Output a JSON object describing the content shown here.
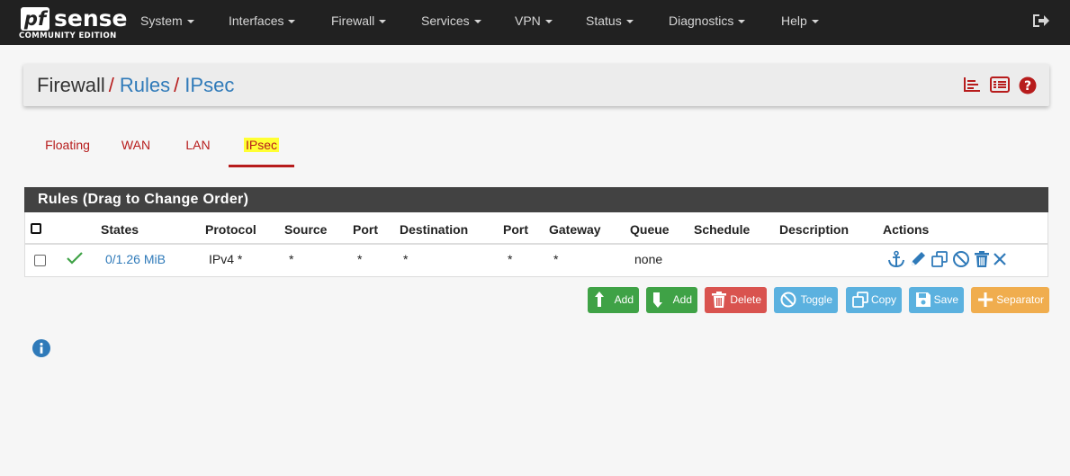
{
  "brand": {
    "logo_mark": "pf",
    "logo_word": "sense",
    "edition": "COMMUNITY EDITION"
  },
  "nav": {
    "items": [
      "System",
      "Interfaces",
      "Firewall",
      "Services",
      "VPN",
      "Status",
      "Diagnostics",
      "Help"
    ],
    "logout_icon": "sign-out-icon"
  },
  "breadcrumb": {
    "root": "Firewall",
    "sep1": "/",
    "level1": "Rules",
    "sep2": "/",
    "level2": "IPsec",
    "icons": [
      "chart-icon",
      "list-icon",
      "help-icon"
    ]
  },
  "tabs": [
    {
      "label": "Floating",
      "active": false
    },
    {
      "label": "WAN",
      "active": false
    },
    {
      "label": "LAN",
      "active": false
    },
    {
      "label": "IPsec",
      "active": true
    }
  ],
  "rules": {
    "title": "Rules (Drag to Change Order)",
    "columns": [
      "States",
      "Protocol",
      "Source",
      "Port",
      "Destination",
      "Port",
      "Gateway",
      "Queue",
      "Schedule",
      "Description",
      "Actions"
    ],
    "rows": [
      {
        "checked": false,
        "status": "check-icon",
        "states": "0/1.26 MiB",
        "protocol": "IPv4 *",
        "source": "*",
        "source_port": "*",
        "destination": "*",
        "destination_port": "*",
        "gateway": "*",
        "queue": "none",
        "schedule": "",
        "description": "",
        "actions": [
          "anchor-icon",
          "pencil-icon",
          "copy-icon",
          "disable-icon",
          "trash-icon",
          "times-icon"
        ]
      }
    ]
  },
  "buttons": {
    "add_top": "Add",
    "add_bottom": "Add",
    "delete": "Delete",
    "toggle": "Toggle",
    "copy": "Copy",
    "save": "Save",
    "separator": "Separator"
  },
  "colors": {
    "navbar": "#212121",
    "accent_red": "#b71c1c",
    "link_blue": "#2f7ab9",
    "green": "#3fa246",
    "danger": "#d9534f",
    "info": "#5bb1df",
    "warning": "#f0ad4e",
    "tab_highlight": "#ffff33"
  }
}
